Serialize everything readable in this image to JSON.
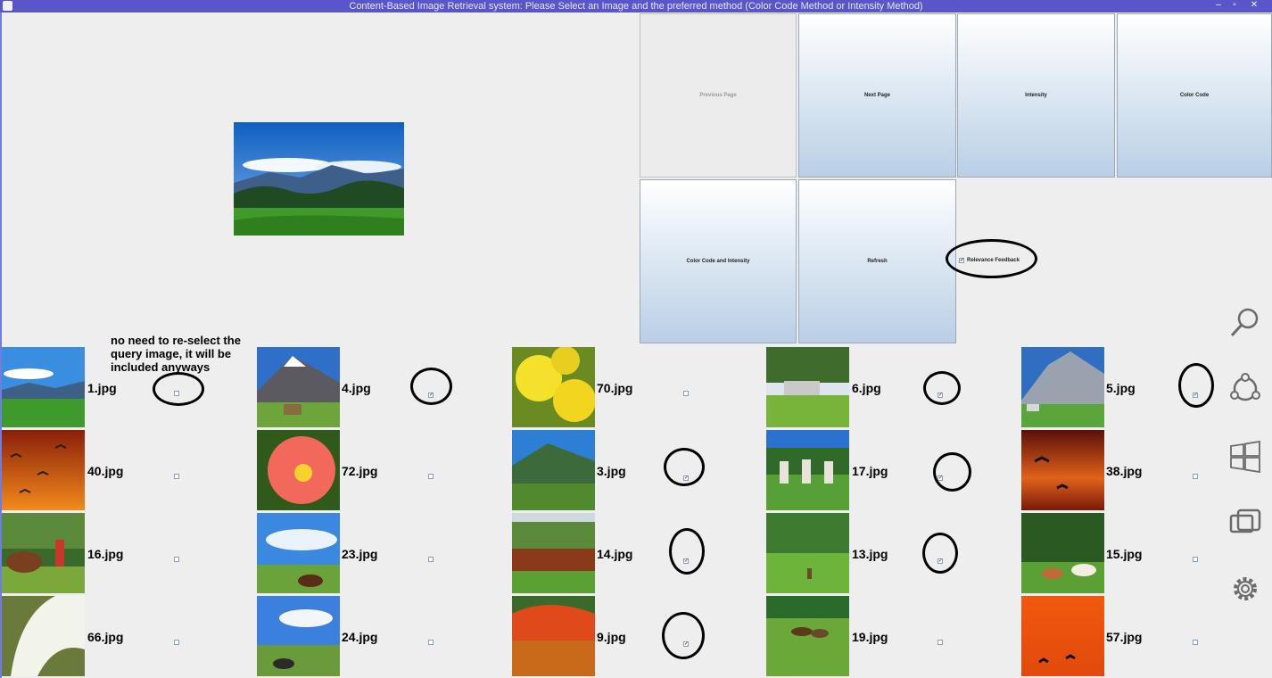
{
  "window": {
    "title": "Content-Based Image Retrieval system: Please Select an Image and the preferred method (Color Code Method or Intensity Method)"
  },
  "buttons": {
    "previous": "Previous Page",
    "next": "Next Page",
    "intensity": "Intensity",
    "color_code": "Color Code",
    "color_code_intensity": "Color Code and Intensity",
    "refresh": "Refresh"
  },
  "relevance_feedback": {
    "label": "Relevance Feedback",
    "checked": true
  },
  "annotation": {
    "note": "no need to re-select the query image, it will be included anyways"
  },
  "images": [
    {
      "file": "1.jpg",
      "checked": false
    },
    {
      "file": "4.jpg",
      "checked": true
    },
    {
      "file": "70.jpg",
      "checked": false
    },
    {
      "file": "6.jpg",
      "checked": true
    },
    {
      "file": "5.jpg",
      "checked": true
    },
    {
      "file": "40.jpg",
      "checked": false
    },
    {
      "file": "72.jpg",
      "checked": false
    },
    {
      "file": "3.jpg",
      "checked": true
    },
    {
      "file": "17.jpg",
      "checked": true
    },
    {
      "file": "38.jpg",
      "checked": false
    },
    {
      "file": "16.jpg",
      "checked": false
    },
    {
      "file": "23.jpg",
      "checked": false
    },
    {
      "file": "14.jpg",
      "checked": true
    },
    {
      "file": "13.jpg",
      "checked": true
    },
    {
      "file": "15.jpg",
      "checked": false
    },
    {
      "file": "66.jpg",
      "checked": false
    },
    {
      "file": "24.jpg",
      "checked": false
    },
    {
      "file": "9.jpg",
      "checked": true
    },
    {
      "file": "19.jpg",
      "checked": false
    },
    {
      "file": "57.jpg",
      "checked": false
    }
  ],
  "charms": [
    "search-icon",
    "share-icon",
    "start-icon",
    "devices-icon",
    "settings-icon"
  ],
  "colors": {
    "titlebar": "#5a55c8",
    "button_gradient_bottom": "#b9cfe6",
    "annotation": "#000000"
  }
}
